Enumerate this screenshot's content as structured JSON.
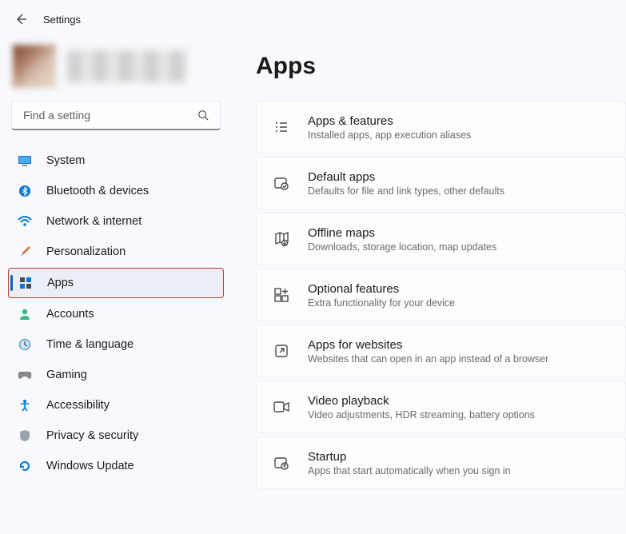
{
  "header": {
    "title": "Settings"
  },
  "search": {
    "placeholder": "Find a setting"
  },
  "page": {
    "title": "Apps"
  },
  "sidebar": {
    "items": [
      {
        "label": "System"
      },
      {
        "label": "Bluetooth & devices"
      },
      {
        "label": "Network & internet"
      },
      {
        "label": "Personalization"
      },
      {
        "label": "Apps"
      },
      {
        "label": "Accounts"
      },
      {
        "label": "Time & language"
      },
      {
        "label": "Gaming"
      },
      {
        "label": "Accessibility"
      },
      {
        "label": "Privacy & security"
      },
      {
        "label": "Windows Update"
      }
    ]
  },
  "cards": [
    {
      "title": "Apps & features",
      "sub": "Installed apps, app execution aliases"
    },
    {
      "title": "Default apps",
      "sub": "Defaults for file and link types, other defaults"
    },
    {
      "title": "Offline maps",
      "sub": "Downloads, storage location, map updates"
    },
    {
      "title": "Optional features",
      "sub": "Extra functionality for your device"
    },
    {
      "title": "Apps for websites",
      "sub": "Websites that can open in an app instead of a browser"
    },
    {
      "title": "Video playback",
      "sub": "Video adjustments, HDR streaming, battery options"
    },
    {
      "title": "Startup",
      "sub": "Apps that start automatically when you sign in"
    }
  ]
}
